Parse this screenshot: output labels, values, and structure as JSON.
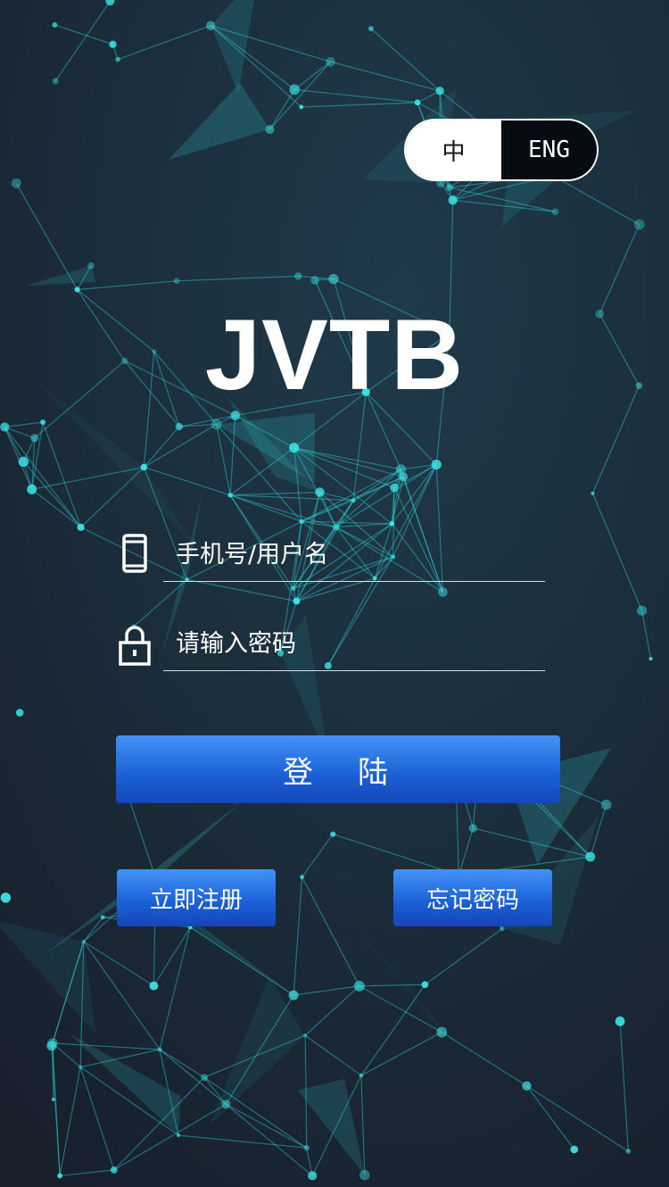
{
  "language_toggle": {
    "zh_label": "中",
    "en_label": "ENG",
    "active": "ENG"
  },
  "logo": {
    "text": "JVTB"
  },
  "form": {
    "username": {
      "placeholder": "手机号/用户名",
      "value": "",
      "icon": "phone-icon"
    },
    "password": {
      "placeholder": "请输入密码",
      "value": "",
      "icon": "lock-icon"
    }
  },
  "buttons": {
    "login_label": "登陆",
    "register_label": "立即注册",
    "forgot_label": "忘记密码"
  },
  "colors": {
    "background": "#1b2433",
    "network_accent": "#2ee6e6",
    "button_blue": "#1a5fd6",
    "toggle_active_bg": "#060b14"
  }
}
